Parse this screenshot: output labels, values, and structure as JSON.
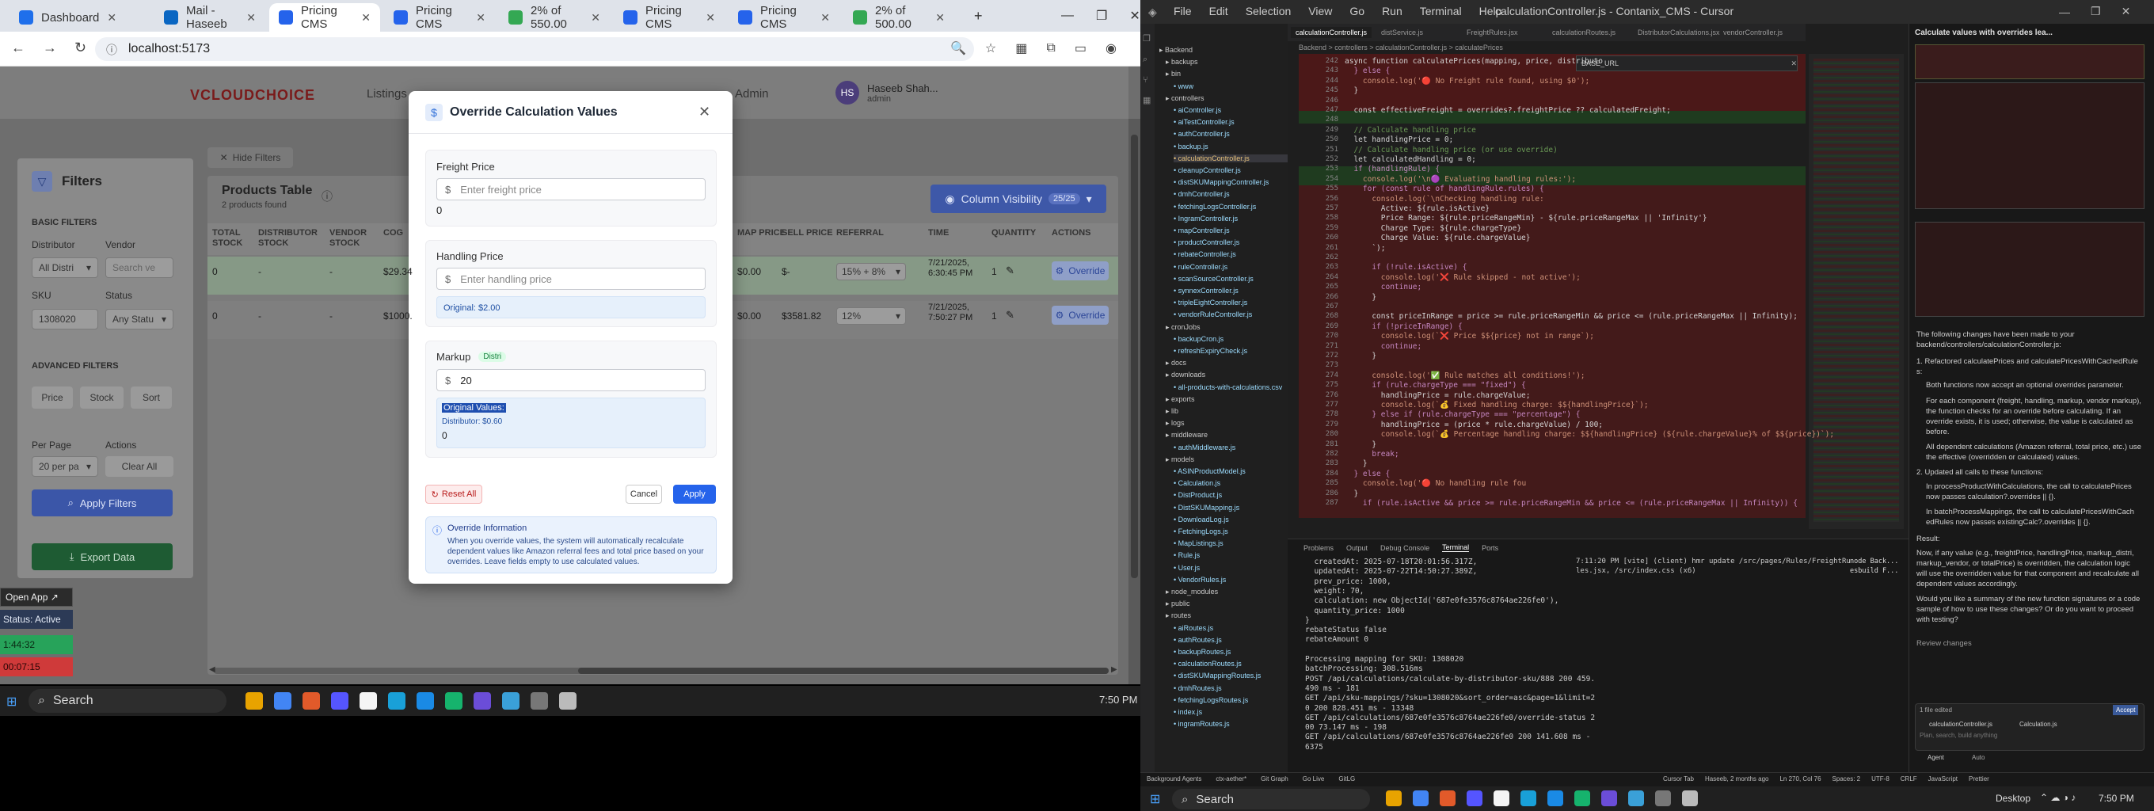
{
  "browser": {
    "tabs": [
      {
        "label": "Dashboard",
        "color": "#1f6feb"
      },
      {
        "label": "Mail - Haseeb",
        "color": "#0a66c2"
      },
      {
        "label": "Pricing CMS",
        "color": "#2563eb"
      },
      {
        "label": "Pricing CMS",
        "color": "#2563eb"
      },
      {
        "label": "2% of 550.00",
        "color": "#34a853"
      },
      {
        "label": "Pricing CMS",
        "color": "#2563eb"
      },
      {
        "label": "Pricing CMS",
        "color": "#2563eb"
      },
      {
        "label": "2% of 500.00",
        "color": "#34a853"
      }
    ],
    "url": "localhost:5173"
  },
  "app": {
    "logo": "VCLOUDCHOICE",
    "nav": [
      "Listings",
      "Admin"
    ],
    "user": {
      "initials": "HS",
      "name": "Haseeb Shah...",
      "role": "admin"
    },
    "hide_filters": "Hide Filters",
    "filters": {
      "title": "Filters",
      "basic": "BASIC FILTERS",
      "distributor_label": "Distributor",
      "distributor_value": "All Distri",
      "vendor_label": "Vendor",
      "vendor_placeholder": "Search ve",
      "sku_label": "SKU",
      "sku_value": "1308020",
      "status_label": "Status",
      "status_value": "Any Statu",
      "advanced": "ADVANCED FILTERS",
      "adv_buttons": [
        "Price",
        "Stock",
        "Sort"
      ],
      "per_page_label": "Per Page",
      "per_page_value": "20 per pa",
      "actions_label": "Actions",
      "clear_all": "Clear All",
      "apply": "Apply Filters",
      "export": "Export Data"
    },
    "table": {
      "title": "Products Table",
      "count": "2 products found",
      "column_visibility": "Column Visibility",
      "column_badge": "25/25",
      "headers": [
        "TOTAL STOCK",
        "DISTRIBUTOR STOCK",
        "VENDOR STOCK",
        "COG",
        "MAP PRICE",
        "SELL PRICE",
        "REFERRAL",
        "TIME",
        "QUANTITY",
        "ACTIONS"
      ],
      "rows": [
        {
          "total": "0",
          "dist": "-",
          "vendor": "-",
          "cog": "$29.34",
          "map": "$0.00",
          "sell": "$-",
          "referral": "15% + 8%",
          "time": "7/21/2025, 6:30:45 PM",
          "qty": "1",
          "action": "Override"
        },
        {
          "total": "0",
          "dist": "-",
          "vendor": "-",
          "cog": "$1000.",
          "map": "$0.00",
          "sell": "$3581.82",
          "referral": "12%",
          "time": "7/21/2025, 7:50:27 PM",
          "qty": "1",
          "action": "Override"
        }
      ]
    },
    "overlay": {
      "open_app": "Open App ↗",
      "status": "Status: Active",
      "time1": "1:44:32",
      "time2": "00:07:15"
    }
  },
  "modal": {
    "title": "Override Calculation Values",
    "freight_label": "Freight Price",
    "freight_placeholder": "Enter freight price",
    "freight_value": "0",
    "handling_label": "Handling Price",
    "handling_placeholder": "Enter handling price",
    "handling_original": "Original: $2.00",
    "markup_label": "Markup",
    "markup_badge": "Distri",
    "markup_value": "20",
    "original_values": "Original Values:",
    "original_distributor": "Distributor: $0.60",
    "original_zero": "0",
    "reset": "Reset All",
    "cancel": "Cancel",
    "apply": "Apply",
    "info_title": "Override Information",
    "info_text": "When you override values, the system will automatically recalculate dependent values like Amazon referral fees and total price based on your overrides. Leave fields empty to use calculated values.",
    "currency": "$"
  },
  "windows_taskbar_left": {
    "search": "Search",
    "clock": "7:50 PM"
  },
  "vscode": {
    "title": "calculationController.js - Contanix_CMS - Cursor",
    "menu": [
      "File",
      "Edit",
      "Selection",
      "View",
      "Go",
      "Run",
      "Terminal",
      "Help"
    ],
    "tabs": [
      "calculationController.js",
      "distService.js",
      "FreightRules.jsx",
      "calculationRoutes.js",
      "DistributorCalculations.jsx",
      "vendorController.js"
    ],
    "breadcrumb": "Backend > controllers > calculationController.js > calculatePrices",
    "find_text": "BASE_URL",
    "explorer": [
      "Backend",
      "backups",
      "bin",
      "www",
      "controllers",
      "aiController.js",
      "aiTestController.js",
      "authController.js",
      "backup.js",
      "calculationController.js",
      "cleanupController.js",
      "distSKUMappingController.js",
      "dmhController.js",
      "fetchingLogsController.js",
      "IngramController.js",
      "mapController.js",
      "productController.js",
      "rebateController.js",
      "ruleController.js",
      "scanSourceController.js",
      "synnexController.js",
      "tripleEightController.js",
      "vendorRuleController.js",
      "cronJobs",
      "backupCron.js",
      "refreshExpiryCheck.js",
      "docs",
      "downloads",
      "all-products-with-calculations.csv",
      "exports",
      "lib",
      "logs",
      "middleware",
      "authMiddleware.js",
      "models",
      "ASINProductModel.js",
      "Calculation.js",
      "DistProduct.js",
      "DistSKUMapping.js",
      "DownloadLog.js",
      "FetchingLogs.js",
      "MapListings.js",
      "Rule.js",
      "User.js",
      "VendorRules.js",
      "node_modules",
      "public",
      "routes",
      "aiRoutes.js",
      "authRoutes.js",
      "backupRoutes.js",
      "calculationRoutes.js",
      "distSKUMappingRoutes.js",
      "dmhRoutes.js",
      "fetchingLogsRoutes.js",
      "index.js",
      "ingramRoutes.js"
    ],
    "line_numbers": [
      "242",
      "243",
      "244",
      "245",
      "246",
      "247",
      "248",
      "249",
      "250",
      "251",
      "252",
      "253",
      "254",
      "255",
      "256",
      "257",
      "258",
      "259",
      "260",
      "261",
      "262",
      "263",
      "264",
      "265",
      "266",
      "267",
      "268",
      "269",
      "270",
      "271",
      "272",
      "273",
      "274",
      "275",
      "276",
      "277",
      "278",
      "279",
      "280",
      "281",
      "282",
      "283",
      "284",
      "285",
      "286",
      "287",
      "288",
      "289",
      "290",
      "291",
      "292",
      "293",
      "294",
      "295",
      "296",
      "297",
      "298",
      "299",
      "300",
      "301",
      "302",
      "303",
      "304",
      "305",
      "306"
    ],
    "code": [
      "async function calculatePrices(mapping, price, distributo",
      "  } else {",
      "    console.log('🔴 No Freight rule found, using $0');",
      "  }",
      "",
      "  const effectiveFreight = overrides?.freightPrice ?? calculatedFreight;",
      "",
      "  // Calculate handling price",
      "  let handlingPrice = 0;",
      "  // Calculate handling price (or use override)",
      "  let calculatedHandling = 0;",
      "  if (handlingRule) {",
      "    console.log('\\n🟣 Evaluating handling rules:');",
      "    for (const rule of handlingRule.rules) {",
      "      console.log(`\\nChecking handling rule:",
      "        Active: ${rule.isActive}",
      "        Price Range: ${rule.priceRangeMin} - ${rule.priceRangeMax || 'Infinity'}",
      "        Charge Type: ${rule.chargeType}",
      "        Charge Value: ${rule.chargeValue}",
      "      `);",
      "",
      "      if (!rule.isActive) {",
      "        console.log('❌ Rule skipped - not active');",
      "        continue;",
      "      }",
      "",
      "      const priceInRange = price >= rule.priceRangeMin && price <= (rule.priceRangeMax || Infinity);",
      "      if (!priceInRange) {",
      "        console.log(`❌ Price $${price} not in range`);",
      "        continue;",
      "      }",
      "",
      "      console.log('✅ Rule matches all conditions!');",
      "      if (rule.chargeType === \"fixed\") {",
      "        handlingPrice = rule.chargeValue;",
      "        console.log(`💰 Fixed handling charge: $${handlingPrice}`);",
      "      } else if (rule.chargeType === \"percentage\") {",
      "        handlingPrice = (price * rule.chargeValue) / 100;",
      "        console.log(`💰 Percentage handling charge: $${handlingPrice} (${rule.chargeValue}% of $${price})`);",
      "      }",
      "      break;",
      "    }",
      "  } else {",
      "    console.log('🔴 No handling rule fou",
      "  }",
      "    if (rule.isActive && price >= rule.priceRangeMin && price <= (rule.priceRangeMax || Infinity)) {"
    ],
    "panel_tabs": [
      "Problems",
      "Output",
      "Debug Console",
      "Terminal",
      "Ports"
    ],
    "terminal_left": [
      "  createdAt: 2025-07-18T20:01:56.317Z,",
      "  updatedAt: 2025-07-22T14:50:27.389Z,",
      "  prev_price: 1000,",
      "  weight: 70,",
      "  calculation: new ObjectId('687e0fe3576c8764ae226fe0'),",
      "  quantity_price: 1000",
      "}",
      "rebateStatus false",
      "rebateAmount 0",
      "",
      "Processing mapping for SKU: 1308020",
      "batchProcessing: 308.516ms",
      "POST /api/calculations/calculate-by-distributor-sku/888 200 459.",
      "490 ms - 181",
      "GET /api/sku-mappings/?sku=1308020&sort_order=asc&page=1&limit=2",
      "0 200 828.451 ms - 13348",
      "GET /api/calculations/687e0fe3576c8764ae226fe0/override-status 2",
      "00 73.147 ms - 198",
      "GET /api/calculations/687e0fe3576c8764ae226fe0 200 141.608 ms -",
      "6375"
    ],
    "terminal_right": [
      "7:11:20 PM [vite] (client) hmr update /src/pages/Rules/FreightRu",
      "les.jsx, /src/index.css (x6)"
    ],
    "terminal_list": [
      "node Back...",
      "esbuild F..."
    ],
    "chat": {
      "header": "Calculate values with overrides lea...",
      "intro": "The following changes have been made to your backend/controllers/calculationController.js:",
      "p1": "1. Refactored calculatePrices and calculatePricesWithCachedRule s:",
      "b1": "Both functions now accept an optional overrides parameter.",
      "b2": "For each component (freight, handling, markup, vendor markup), the function checks for an override before calculating. If an override exists, it is used; otherwise, the value is calculated as before.",
      "b3": "All dependent calculations (Amazon referral, total price, etc.) use the effective (overridden or calculated) values.",
      "p2": "2. Updated all calls to these functions:",
      "b4": "In processProductWithCalculations, the call to calculatePrices now passes calculation?.overrides || {}.",
      "b5": "In batchProcessMappings, the call to calculatePricesWithCach edRules now passes existingCalc?.overrides || {}.",
      "result": "Result:",
      "result_text": "Now, if any value (e.g., freightPrice, handlingPrice, markup_distri, markup_vendor, or totalPrice) is overridden, the calculation logic will use the overridden value for that component and recalculate all dependent values accordingly.",
      "question": "Would you like a summary of the new function signatures or a code sample of how to use these changes? Or do you want to proceed with testing?",
      "review": "Review changes",
      "files_edited": "1 file edited",
      "accept": "Accept",
      "files": [
        "calculationController.js",
        "Calculation.js"
      ],
      "input_placeholder": "Plan, search, build anything",
      "agent": "Agent",
      "auto": "Auto"
    },
    "status": {
      "left": [
        "Background Agents",
        "ctx-aether*",
        "Git Graph",
        "Go Live",
        "GitLG"
      ],
      "right": [
        "Cursor Tab",
        "Haseeb, 2 months ago",
        "Ln 270, Col 76",
        "Spaces: 2",
        "UTF-8",
        "CRLF",
        "JavaScript",
        "Prettier"
      ]
    }
  },
  "windows_taskbar_right": {
    "search": "Search",
    "desktop": "Desktop",
    "clock": "7:50 PM"
  }
}
